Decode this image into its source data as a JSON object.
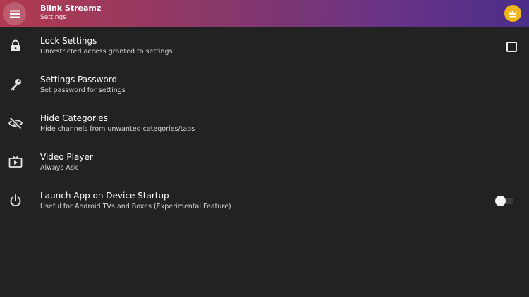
{
  "header": {
    "title": "Blink Streamz",
    "subtitle": "Settings",
    "menu_icon": "hamburger-menu-icon",
    "premium_icon": "crown-icon",
    "gradient_colors": [
      "#b13a4f",
      "#6a3485",
      "#4b2e8a"
    ],
    "premium_color": "#f2b61c"
  },
  "settings": [
    {
      "title": "Lock Settings",
      "description": "Unrestricted access granted to settings",
      "icon": "lock-icon",
      "control": "checkbox",
      "checked": false
    },
    {
      "title": "Settings Password",
      "description": "Set password for settings",
      "icon": "key-icon"
    },
    {
      "title": "Hide Categories",
      "description": "Hide channels from unwanted categories/tabs",
      "icon": "eye-off-icon"
    },
    {
      "title": "Video Player",
      "description": "Always Ask",
      "icon": "video-player-icon"
    },
    {
      "title": "Launch App on Device Startup",
      "description": "Useful for Android TVs and Boxes (Experimental Feature)",
      "icon": "power-icon",
      "control": "toggle",
      "enabled": false
    }
  ]
}
